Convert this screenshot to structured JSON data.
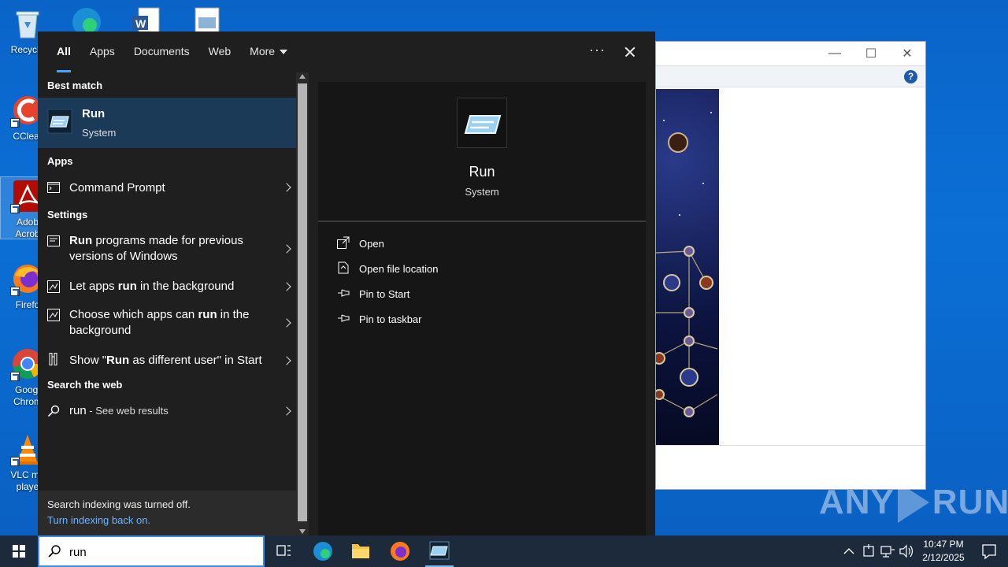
{
  "desktop": {
    "icons": [
      {
        "label": "Recycle",
        "name": "recycle-bin"
      },
      {
        "label": "CClear",
        "name": "ccleaner"
      },
      {
        "label": "Adob\nAcrob",
        "name": "adobe-acrobat"
      },
      {
        "label": "Firefo",
        "name": "firefox"
      },
      {
        "label": "Googl\nChrom",
        "name": "google-chrome"
      },
      {
        "label": "VLC me\nplaye",
        "name": "vlc-media-player"
      }
    ]
  },
  "watermark": {
    "left": "ANY",
    "right": "RUN"
  },
  "search_panel": {
    "tabs": [
      {
        "label": "All",
        "active": true
      },
      {
        "label": "Apps"
      },
      {
        "label": "Documents"
      },
      {
        "label": "Web"
      },
      {
        "label": "More"
      }
    ],
    "more_options": "···",
    "best_match_heading": "Best match",
    "best_match": {
      "title": "Run",
      "subtitle": "System"
    },
    "apps_heading": "Apps",
    "apps": [
      {
        "label": "Command Prompt"
      }
    ],
    "settings_heading": "Settings",
    "settings": [
      {
        "pre": "",
        "bold": "Run",
        "post": " programs made for previous versions of Windows"
      },
      {
        "pre": "Let apps ",
        "bold": "run",
        "post": " in the background"
      },
      {
        "pre": "Choose which apps can ",
        "bold": "run",
        "post": " in the background"
      },
      {
        "pre": "Show \"",
        "bold": "Run",
        "post": " as different user\" in Start"
      }
    ],
    "web_heading": "Search the web",
    "web_result": {
      "query": "run",
      "suffix": " - See web results"
    },
    "footer": {
      "note": "Search indexing was turned off.",
      "link": "Turn indexing back on."
    }
  },
  "preview": {
    "title": "Run",
    "subtitle": "System",
    "actions": [
      {
        "label": "Open",
        "icon": "open-icon"
      },
      {
        "label": "Open file location",
        "icon": "file-location-icon"
      },
      {
        "label": "Pin to Start",
        "icon": "pin-icon"
      },
      {
        "label": "Pin to taskbar",
        "icon": "pin-icon"
      }
    ]
  },
  "taskbar": {
    "search_value": "run",
    "time": "10:47 PM",
    "date": "2/12/2025"
  },
  "colors": {
    "accent": "#4aa3ff",
    "selected_bg": "#1a3a58",
    "panel_bg": "#1f1f1f",
    "desktop_bg": "#0b6fd6",
    "taskbar_bg": "#1c2a3c"
  }
}
